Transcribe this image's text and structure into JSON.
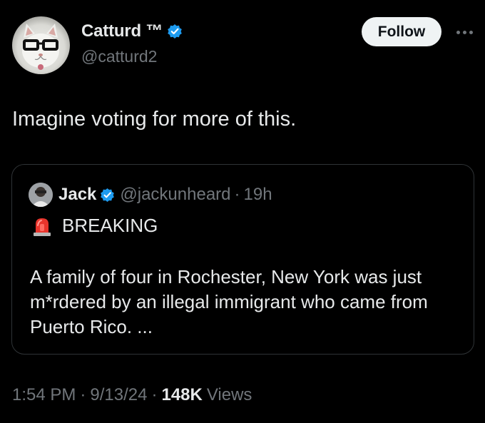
{
  "author": {
    "display_name": "Catturd ™",
    "handle": "@catturd2",
    "verified": true,
    "follow_label": "Follow"
  },
  "tweet": {
    "text": "Imagine voting for more of this."
  },
  "quote": {
    "name": "Jack",
    "handle": "@jackunheard",
    "separator": "·",
    "time": "19h",
    "breaking": "BREAKING",
    "body_lines": [
      "A family of four in Rochester, New York was just",
      "m*rdered by an illegal immigrant who came from",
      "Puerto Rico. ..."
    ]
  },
  "meta": {
    "time": "1:54 PM",
    "sep1": "·",
    "date": "9/13/24",
    "sep2": "·",
    "views_count": "148K",
    "views_label": "Views"
  },
  "colors": {
    "background": "#000000",
    "text": "#e7e9ea",
    "muted": "#71767b",
    "verified_blue": "#1d9bf0",
    "border": "#2f3336"
  }
}
